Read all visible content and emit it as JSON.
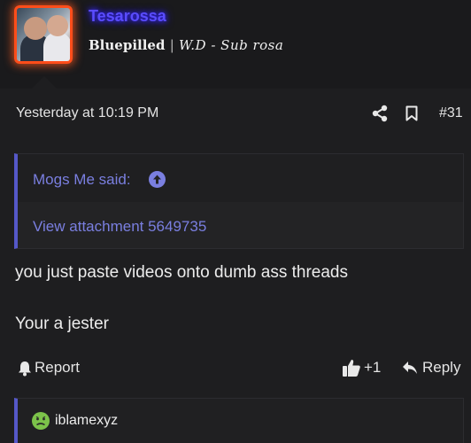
{
  "user": {
    "name": "Tesarossa",
    "title_left": "Bluepilled",
    "title_sep": "|",
    "title_sig": "W.D - Sub rosa"
  },
  "meta": {
    "timestamp": "Yesterday at 10:19 PM",
    "post_number": "#31"
  },
  "quote": {
    "author": "Mogs Me said:",
    "link": "View attachment 5649735"
  },
  "body": {
    "lines": [
      "you just paste videos onto dumb ass threads",
      "Your a jester"
    ]
  },
  "actions": {
    "report": "Report",
    "like_count": "+1",
    "reply": "Reply"
  },
  "reactions": {
    "user": "iblamexyz",
    "emoji": "nauseated-face"
  },
  "colors": {
    "background": "#1e1e20",
    "accent": "#7a7fe0",
    "quote_bar": "#5558c8",
    "username": "#5a4cff",
    "avatar_border": "#ff4d1a"
  }
}
